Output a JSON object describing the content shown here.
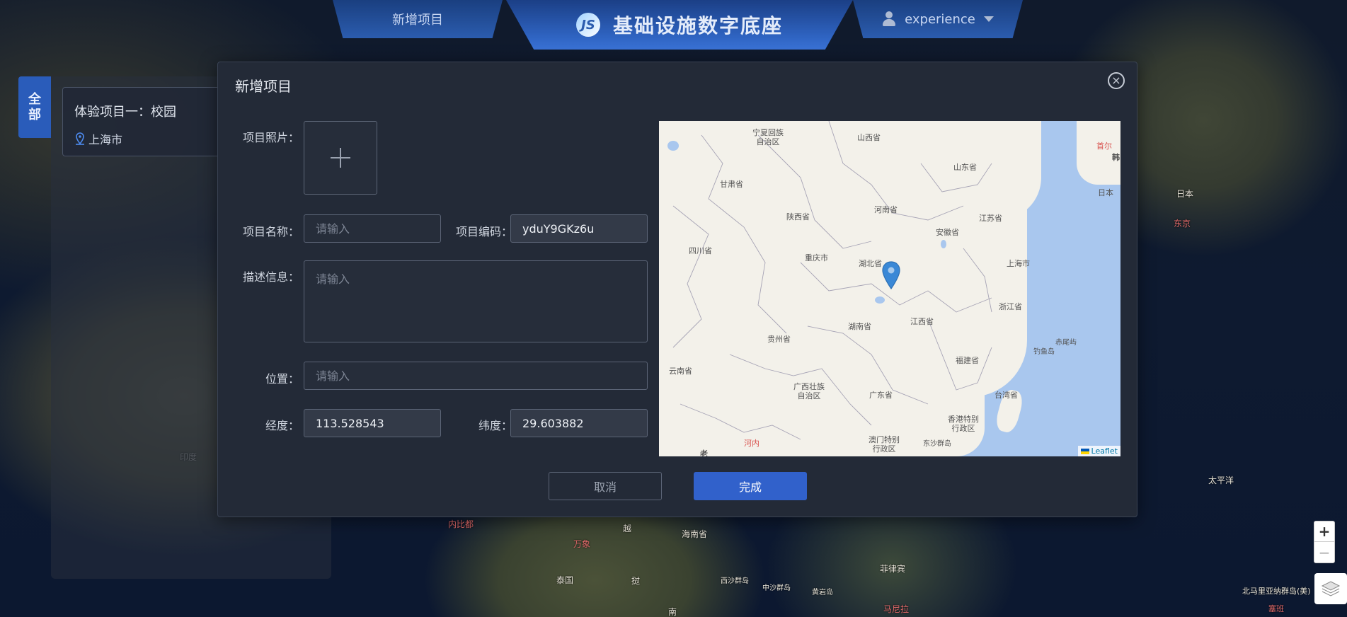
{
  "nav": {
    "left_tab": "新增项目",
    "brand_logo": "JS",
    "brand_title": "基础设施数字底座",
    "user_name": "experience"
  },
  "side": {
    "filter_tab": "全部",
    "project": {
      "title": "体验项目一：校园",
      "location": "上海市"
    }
  },
  "modal": {
    "title": "新增项目",
    "labels": {
      "photo": "项目照片：",
      "name": "项目名称：",
      "code": "项目编码：",
      "desc": "描述信息：",
      "location": "位置：",
      "longitude": "经度：",
      "latitude": "纬度："
    },
    "fields": {
      "name_placeholder": "请输入",
      "code_value": "yduY9GKz6u",
      "desc_placeholder": "请输入",
      "location_placeholder": "请输入",
      "longitude_value": "113.528543",
      "latitude_value": "29.603882"
    },
    "buttons": {
      "cancel": "取消",
      "ok": "完成"
    },
    "map": {
      "attribution": "Leaflet",
      "provinces": [
        {
          "name": "宁夏回族\n自治区"
        },
        {
          "name": "山西省"
        },
        {
          "name": "山东省"
        },
        {
          "name": "甘肃省"
        },
        {
          "name": "河南省"
        },
        {
          "name": "江苏省"
        },
        {
          "name": "陕西省"
        },
        {
          "name": "安徽省"
        },
        {
          "name": "四川省"
        },
        {
          "name": "重庆市"
        },
        {
          "name": "湖北省"
        },
        {
          "name": "上海市"
        },
        {
          "name": "浙江省"
        },
        {
          "name": "湖南省"
        },
        {
          "name": "江西省"
        },
        {
          "name": "贵州省"
        },
        {
          "name": "赤尾屿"
        },
        {
          "name": "钓鱼岛"
        },
        {
          "name": "福建省"
        },
        {
          "name": "云南省"
        },
        {
          "name": "广西壮族\n自治区"
        },
        {
          "name": "广东省"
        },
        {
          "name": "台湾省"
        },
        {
          "name": "香港特别\n行政区"
        },
        {
          "name": "澳门特别\n行政区"
        },
        {
          "name": "东沙群岛"
        },
        {
          "name": "日本"
        },
        {
          "name": "韩"
        },
        {
          "name": "老"
        }
      ],
      "cities": [
        "首尔",
        "河内"
      ]
    }
  },
  "background_labels": [
    "日本",
    "东京",
    "太平洋",
    "海南省",
    "菲律宾",
    "西沙群岛",
    "中沙群岛",
    "黄岩岛",
    "北马里亚纳群岛(美)",
    "泰国",
    "万象",
    "越",
    "挝",
    "印度",
    "内比都",
    "马尼拉",
    "塞班",
    "南"
  ],
  "controls": {
    "zoom_in": "+",
    "zoom_out": "−"
  }
}
